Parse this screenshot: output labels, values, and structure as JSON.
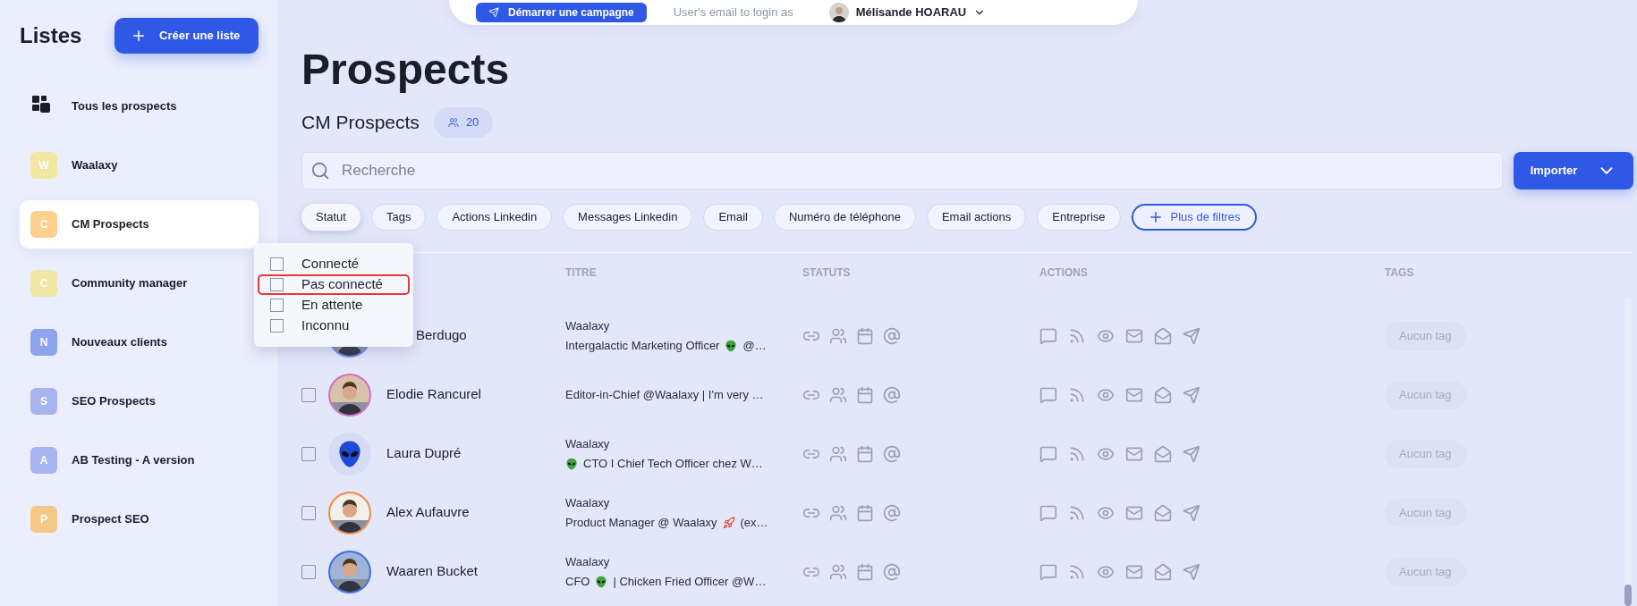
{
  "topbar": {
    "campaign_button": "Démarrer une campagne",
    "login_hint": "User's email to login as",
    "user": "Mélisande HOARAU"
  },
  "sidebar": {
    "title": "Listes",
    "create_button": "Créer une liste",
    "items": [
      {
        "kind": "all",
        "label": "Tous les prospects",
        "selected": false
      },
      {
        "kind": "list",
        "letter": "W",
        "label": "Waalaxy",
        "color": "#f2e6a3",
        "selected": false
      },
      {
        "kind": "list",
        "letter": "C",
        "label": "CM Prospects",
        "color": "#fdd08c",
        "selected": true
      },
      {
        "kind": "list",
        "letter": "C",
        "label": "Community manager",
        "color": "#f1e6a4",
        "selected": false
      },
      {
        "kind": "list",
        "letter": "N",
        "label": "Nouveaux clients",
        "color": "#8ea3ec",
        "selected": false
      },
      {
        "kind": "list",
        "letter": "S",
        "label": "SEO Prospects",
        "color": "#a8b4f0",
        "selected": false
      },
      {
        "kind": "list",
        "letter": "A",
        "label": "AB Testing - A version",
        "color": "#a8b4f0",
        "selected": false
      },
      {
        "kind": "list",
        "letter": "P",
        "label": "Prospect SEO",
        "color": "#f4c987",
        "selected": false
      }
    ]
  },
  "page": {
    "title": "Prospects",
    "list_name": "CM Prospects",
    "count": "20"
  },
  "search": {
    "placeholder": "Recherche"
  },
  "import_button": "Importer",
  "filters": [
    {
      "label": "Statut",
      "selected": true
    },
    {
      "label": "Tags",
      "selected": false
    },
    {
      "label": "Actions Linkedin",
      "selected": false
    },
    {
      "label": "Messages Linkedin",
      "selected": false
    },
    {
      "label": "Email",
      "selected": false
    },
    {
      "label": "Numéro de téléphone",
      "selected": false
    },
    {
      "label": "Email actions",
      "selected": false
    },
    {
      "label": "Entreprise",
      "selected": false
    }
  ],
  "more_filters": "Plus de filtres",
  "status_menu": [
    {
      "label": "Connecté",
      "checked": false,
      "highlighted": false
    },
    {
      "label": "Pas connecté",
      "checked": false,
      "highlighted": true
    },
    {
      "label": "En attente",
      "checked": false,
      "highlighted": false
    },
    {
      "label": "Inconnu",
      "checked": false,
      "highlighted": false
    }
  ],
  "table": {
    "columns": [
      "TITRE",
      "STATUTS",
      "ACTIONS",
      "TAGS"
    ],
    "rows": [
      {
        "name": "Berdugo",
        "company": "Waalaxy",
        "title": [
          {
            "kind": "text",
            "text": "Intergalactic Marketing Officer"
          },
          {
            "kind": "alien"
          },
          {
            "kind": "text",
            "text": "@…"
          }
        ],
        "tag": "Aucun tag"
      },
      {
        "name": "Elodie Rancurel",
        "checked": false,
        "title": [
          {
            "kind": "text",
            "text": "Editor-in-Chief @Waalaxy | I'm very …"
          }
        ],
        "tag": "Aucun tag"
      },
      {
        "name": "Laura Dupré",
        "kind": "alien",
        "checked": false,
        "company": "Waalaxy",
        "title": [
          {
            "kind": "alien"
          },
          {
            "kind": "text",
            "text": "CTO I Chief Tech Officer chez W…"
          }
        ],
        "tag": "Aucun tag"
      },
      {
        "name": "Alex Aufauvre",
        "checked": false,
        "company": "Waalaxy",
        "title": [
          {
            "kind": "text",
            "text": "Product Manager @ Waalaxy"
          },
          {
            "kind": "rocket"
          },
          {
            "kind": "text",
            "text": "(ex…"
          }
        ],
        "tag": "Aucun tag"
      },
      {
        "name": "Waaren Bucket",
        "checked": false,
        "company": "Waalaxy",
        "title": [
          {
            "kind": "text",
            "text": "CFO"
          },
          {
            "kind": "alien"
          },
          {
            "kind": "text",
            "text": "| Chicken Fried Officer @W…"
          }
        ],
        "tag": "Aucun tag"
      }
    ]
  }
}
